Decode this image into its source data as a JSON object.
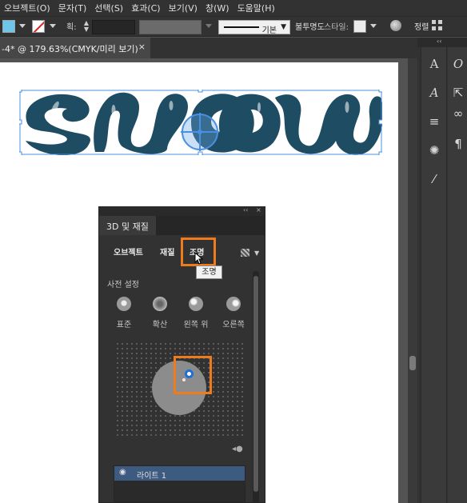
{
  "menu": [
    "오브젝트(O)",
    "문자(T)",
    "선택(S)",
    "효과(C)",
    "보기(V)",
    "창(W)",
    "도움말(H)"
  ],
  "control_bar": {
    "fill_color": "#6ec6e8",
    "stroke_label": "획:",
    "dash_value": "기본",
    "opacity_label": "불투명도",
    "style_label": "스타일:",
    "align_label": "정렬"
  },
  "document_tab": {
    "title": "-4* @ 179.63%(CMYK/미리 보기)",
    "close_symbol": "×"
  },
  "artwork": {
    "letter_color": "#1e4d63"
  },
  "panel": {
    "title": "3D 및 재질",
    "collapse_symbol": "‹‹",
    "close_symbol": "×",
    "tabs": [
      "오브젝트",
      "재질",
      "조명"
    ],
    "active_tab": "조명",
    "tooltip": "조명",
    "presets_label": "사전 설정",
    "presets": [
      "표준",
      "확산",
      "왼쪽 위",
      "오른쪽"
    ],
    "light_name": "라이트 1",
    "highlight_color": "#ee7b1c"
  },
  "right_panel": {
    "collapse_symbol": "‹‹",
    "icons": [
      "character-icon",
      "glyph-icon",
      "paragraph-lines-icon",
      "sun-icon",
      "magic-wand-icon"
    ]
  }
}
